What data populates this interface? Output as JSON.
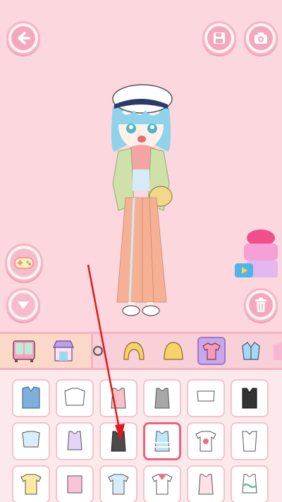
{
  "buttons": {
    "back": "back-arrow-icon",
    "save": "save-disk-icon",
    "camera": "camera-icon",
    "game": "gamepad-icon",
    "collapse": "triangle-down-icon",
    "delete": "trash-icon"
  },
  "colors": {
    "stage_bg": "#fcd7de",
    "button_ring": "#f6b6c4",
    "button_fill": "#f4a8bb",
    "selected_tab": "#c8a8e8",
    "selected_cell": "#f0607f",
    "annotation_arrow": "#e0191f"
  },
  "category_tabs": [
    {
      "icon": "wardrobe-icon",
      "selected": false
    },
    {
      "icon": "shop-icon",
      "selected": false
    },
    {
      "icon": "glasses-icon",
      "selected": false
    },
    {
      "icon": "hair-front-icon",
      "selected": false
    },
    {
      "icon": "hair-back-icon",
      "selected": false
    },
    {
      "icon": "top-shirt-icon",
      "selected": true
    },
    {
      "icon": "jacket-icon",
      "selected": false
    }
  ],
  "items": [
    {
      "icon": "denim-vest-icon"
    },
    {
      "icon": "white-crop-top-icon"
    },
    {
      "icon": "pink-tank-icon"
    },
    {
      "icon": "gray-tank-icon"
    },
    {
      "icon": "white-bandeau-icon"
    },
    {
      "icon": "black-vest-icon"
    },
    {
      "icon": "tie-front-top-icon"
    },
    {
      "icon": "lilac-tank-icon"
    },
    {
      "icon": "black-tank-icon"
    },
    {
      "icon": "striped-tank-icon",
      "selected": true
    },
    {
      "icon": "strawberry-tee-icon"
    },
    {
      "icon": "lace-up-top-icon"
    },
    {
      "icon": "dotted-tee-icon"
    },
    {
      "icon": "pink-heart-top-icon"
    },
    {
      "icon": "blue-print-top-icon"
    },
    {
      "icon": "sailor-top-icon"
    },
    {
      "icon": "bow-top-icon"
    },
    {
      "icon": "green-wave-top-icon"
    }
  ]
}
